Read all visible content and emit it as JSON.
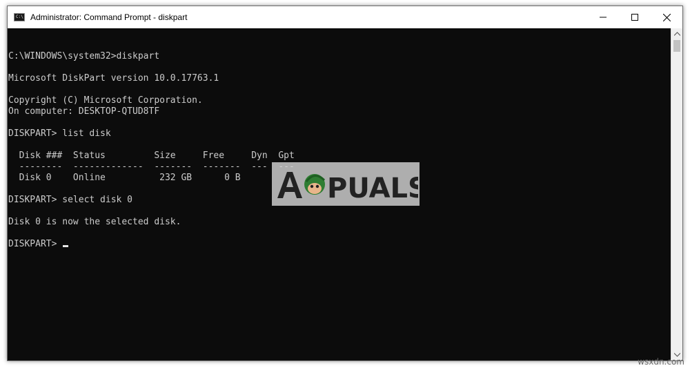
{
  "window": {
    "title": "Administrator: Command Prompt - diskpart",
    "icon": "cmd-icon",
    "icon_text": "C:\\"
  },
  "controls": {
    "minimize": "minimize-icon",
    "maximize": "maximize-icon",
    "close": "close-icon"
  },
  "console": {
    "lines": [
      "",
      "C:\\WINDOWS\\system32>diskpart",
      "",
      "Microsoft DiskPart version 10.0.17763.1",
      "",
      "Copyright (C) Microsoft Corporation.",
      "On computer: DESKTOP-QTUD8TF",
      "",
      "DISKPART> list disk",
      "",
      "  Disk ###  Status         Size     Free     Dyn  Gpt",
      "  --------  -------------  -------  -------  ---  ---",
      "  Disk 0    Online          232 GB      0 B",
      "",
      "DISKPART> select disk 0",
      "",
      "Disk 0 is now the selected disk.",
      "",
      "DISKPART> "
    ],
    "text_color": "#cccccc",
    "background": "#0c0c0c"
  },
  "watermark": {
    "text": "APPUALS"
  },
  "site_mark": "wsxdn.com"
}
